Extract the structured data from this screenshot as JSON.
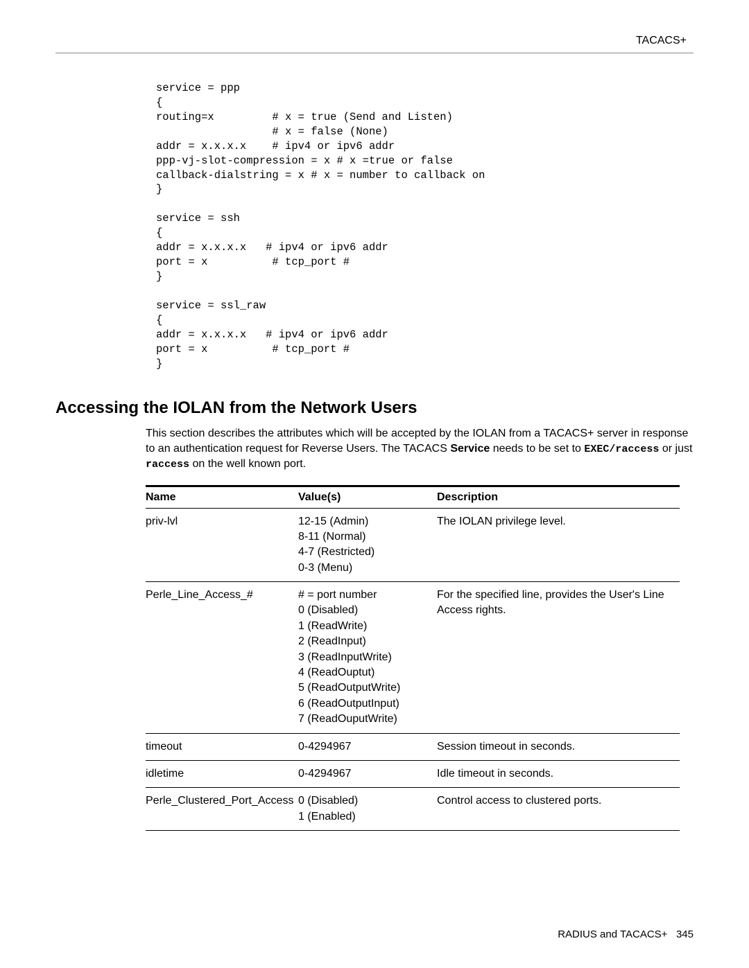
{
  "header": {
    "section": "TACACS+"
  },
  "code": "service = ppp\n{\nrouting=x         # x = true (Send and Listen)\n                  # x = false (None)\naddr = x.x.x.x    # ipv4 or ipv6 addr\nppp-vj-slot-compression = x # x =true or false\ncallback-dialstring = x # x = number to callback on\n}\n\nservice = ssh\n{\naddr = x.x.x.x   # ipv4 or ipv6 addr\nport = x          # tcp_port #\n}\n\nservice = ssl_raw\n{\naddr = x.x.x.x   # ipv4 or ipv6 addr\nport = x          # tcp_port #\n}",
  "heading": "Accessing the IOLAN from the Network Users",
  "intro": {
    "p1a": "This section describes the attributes which will be accepted by the IOLAN from a TACACS+ server in response to an authentication request for Reverse Users. The TACACS",
    "service": " Service",
    "p1b": " needs to be set to ",
    "mono1": "EXEC/raccess",
    "p1c": " or just ",
    "mono2": "raccess",
    "p1d": " on the well known port."
  },
  "table": {
    "headers": {
      "name": "Name",
      "values": "Value(s)",
      "desc": "Description"
    },
    "rows": [
      {
        "name": "priv-lvl",
        "values": "12-15 (Admin)\n8-11   (Normal)\n4-7     (Restricted)\n0-3     (Menu)",
        "desc": "The IOLAN privilege level."
      },
      {
        "name": "Perle_Line_Access_#",
        "values": "# = port number\n0 (Disabled)\n1 (ReadWrite)\n2 (ReadInput)\n3 (ReadInputWrite)\n4 (ReadOuptut)\n5 (ReadOutputWrite)\n6 (ReadOutputInput)\n7 (ReadOuputWrite)",
        "desc": "For the specified line, provides the User's Line Access rights."
      },
      {
        "name": "timeout",
        "values": "0-4294967",
        "desc": "Session timeout in seconds."
      },
      {
        "name": "idletime",
        "values": "0-4294967",
        "desc": "Idle timeout in seconds."
      },
      {
        "name": "Perle_Clustered_Port_Access",
        "values": "0 (Disabled)\n1 (Enabled)",
        "desc": "Control access to clustered ports."
      }
    ]
  },
  "footer": {
    "text": "RADIUS and TACACS+",
    "page": "345"
  }
}
